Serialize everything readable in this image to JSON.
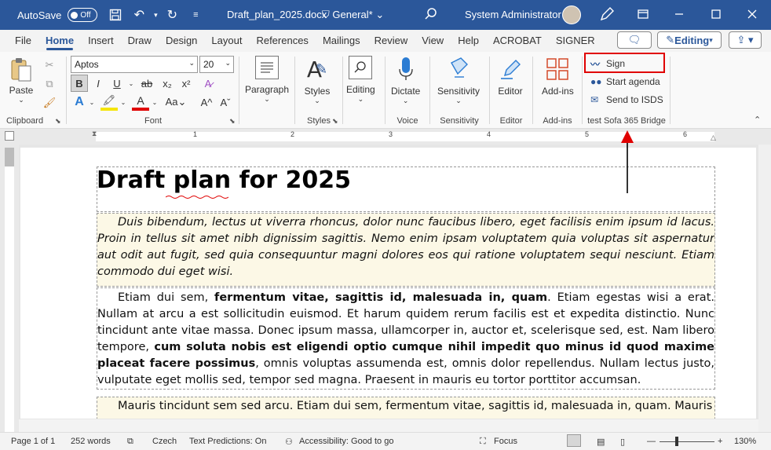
{
  "titlebar": {
    "autosave_label": "AutoSave",
    "autosave_state": "Off",
    "filename": "Draft_plan_2025.docx",
    "sensitivity_label": "General*",
    "user_name": "System Administrator"
  },
  "menu": {
    "tabs": [
      "File",
      "Home",
      "Insert",
      "Draw",
      "Design",
      "Layout",
      "References",
      "Mailings",
      "Review",
      "View",
      "Help",
      "ACROBAT",
      "SIGNER"
    ],
    "active_tab": "Home",
    "editing_label": "Editing"
  },
  "ribbon": {
    "clipboard": {
      "label": "Clipboard",
      "paste": "Paste"
    },
    "font": {
      "label": "Font",
      "family": "Aptos",
      "size": "20"
    },
    "paragraph": {
      "label": "Paragraph"
    },
    "styles": {
      "label": "Styles",
      "button": "Styles"
    },
    "editing": {
      "button": "Editing"
    },
    "voice": {
      "label": "Voice",
      "dictate": "Dictate"
    },
    "sensitivity": {
      "label": "Sensitivity",
      "button": "Sensitivity"
    },
    "editor": {
      "label": "Editor",
      "button": "Editor"
    },
    "addins": {
      "label": "Add-ins",
      "button": "Add-ins"
    },
    "sofa": {
      "label": "test Sofa 365 Bridge",
      "sign": "Sign",
      "start_agenda": "Start agenda",
      "send_isds": "Send to ISDS"
    }
  },
  "ruler": {
    "marks": [
      "1",
      "2",
      "3",
      "4",
      "5",
      "6"
    ]
  },
  "document": {
    "title": "Draft plan for 2025",
    "p1": "Duis bibendum, lectus ut viverra rhoncus, dolor nunc faucibus libero, eget facilisis enim ipsum id lacus. Proin in tellus sit amet nibh dignissim sagittis. Nemo enim ipsam voluptatem quia voluptas sit aspernatur aut odit aut fugit, sed quia consequuntur magni dolores eos qui ratione voluptatem sequi nesciunt. Etiam commodo dui eget wisi.",
    "p2_a": "Etiam dui sem, ",
    "p2_b": "fermentum vitae, sagittis id, malesuada in, quam",
    "p2_c": ". Etiam egestas wisi a erat. Nullam at arcu a est sollicitudin euismod. Et harum quidem rerum facilis est et expedita distinctio. Nunc tincidunt ante vitae massa. Donec ipsum massa, ullamcorper in, auctor et, scelerisque sed, est. Nam libero tempore, ",
    "p2_d": "cum soluta nobis est eligendi optio cumque nihil impedit quo minus id quod maxime placeat facere possimus",
    "p2_e": ", omnis voluptas assumenda est, omnis dolor repellendus. Nullam lectus justo, vulputate eget mollis sed, tempor sed magna. Praesent in mauris eu tortor porttitor accumsan.",
    "p3": "Mauris tincidunt sem sed arcu. Etiam dui sem, fermentum vitae, sagittis id, malesuada in, quam. Mauris"
  },
  "status": {
    "page": "Page 1 of 1",
    "words": "252 words",
    "language": "Czech",
    "predictions": "Text Predictions: On",
    "accessibility": "Accessibility: Good to go",
    "focus": "Focus",
    "zoom": "130%"
  },
  "colors": {
    "accent": "#2b579a",
    "highlight": "#e00000"
  }
}
